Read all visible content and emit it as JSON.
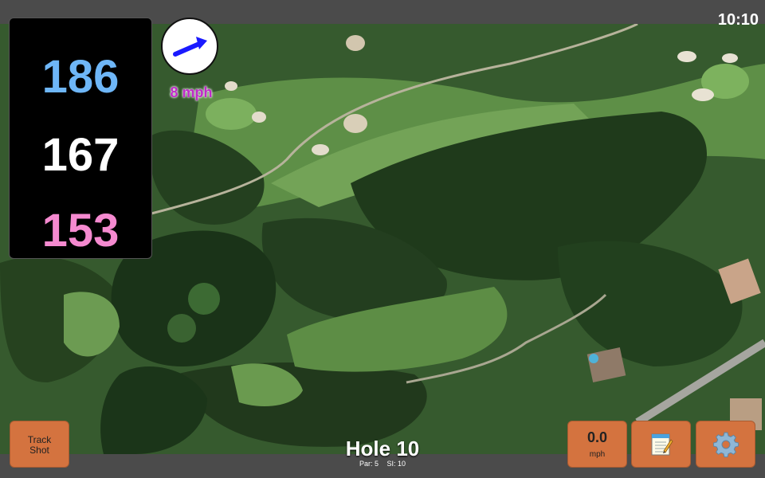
{
  "status": {
    "time": "10:10"
  },
  "distances": {
    "back": "186",
    "middle": "167",
    "front": "153"
  },
  "wind": {
    "speed": "8 mph",
    "icon": "wind-arrow-icon"
  },
  "buttons": {
    "track_shot_line1": "Track",
    "track_shot_line2": "Shot",
    "speed_value": "0.0",
    "speed_unit": "mph",
    "notes_icon": "notepad-icon",
    "settings_icon": "gear-icon"
  },
  "hole": {
    "title": "Hole 10",
    "par": "Par: 5",
    "si": "SI: 10"
  },
  "colors": {
    "back": "#6eb6f7",
    "middle": "#ffffff",
    "front": "#f58ad0",
    "wind_text": "#c02ac9",
    "button": "#d4733f"
  }
}
